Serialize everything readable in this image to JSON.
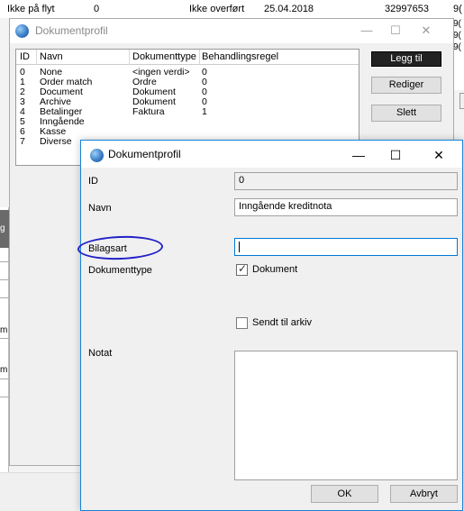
{
  "background": {
    "top_row": [
      "Ikke på flyt",
      "0",
      "Ikke overført",
      "25.04.2018",
      "32997653",
      "9("
    ],
    "right_col": [
      "9(",
      "9(",
      "9("
    ],
    "left_letters": [
      "g",
      "m",
      "m"
    ]
  },
  "window1": {
    "title": "Dokumentprofil",
    "controls": {
      "minimize": "—",
      "maximize": "☐",
      "close": "✕"
    },
    "columns": [
      "ID",
      "Navn",
      "Dokumenttype",
      "Behandlingsregel"
    ],
    "rows": [
      {
        "id": "0",
        "navn": "None",
        "type": "<ingen verdi>",
        "regel": "0"
      },
      {
        "id": "1",
        "navn": "Order match",
        "type": "Ordre",
        "regel": "0"
      },
      {
        "id": "2",
        "navn": "Document",
        "type": "Dokument",
        "regel": "0"
      },
      {
        "id": "3",
        "navn": "Archive",
        "type": "Dokument",
        "regel": "0"
      },
      {
        "id": "4",
        "navn": "Betalinger",
        "type": "Faktura",
        "regel": "1"
      },
      {
        "id": "5",
        "navn": "Inngående",
        "type": "",
        "regel": ""
      },
      {
        "id": "6",
        "navn": "Kasse",
        "type": "",
        "regel": ""
      },
      {
        "id": "7",
        "navn": "Diverse",
        "type": "",
        "regel": ""
      }
    ],
    "buttons": {
      "add": "Legg til",
      "edit": "Rediger",
      "delete": "Slett"
    }
  },
  "dialog": {
    "title": "Dokumentprofil",
    "controls": {
      "minimize": "—",
      "maximize": "☐",
      "close": "✕"
    },
    "labels": {
      "id": "ID",
      "navn": "Navn",
      "bilagsart": "Bilagsart",
      "dokumenttype": "Dokumenttype",
      "notat": "Notat"
    },
    "values": {
      "id": "0",
      "navn": "Inngående kreditnota",
      "bilagsart": ""
    },
    "checkboxes": {
      "dokument": {
        "label": "Dokument",
        "checked": true
      },
      "sendt_til_arkiv": {
        "label": "Sendt til arkiv",
        "checked": false
      }
    },
    "buttons": {
      "ok": "OK",
      "cancel": "Avbryt"
    }
  },
  "colors": {
    "accent": "#1883d7",
    "annotation": "#2222c8",
    "focus": "#0078d7"
  }
}
